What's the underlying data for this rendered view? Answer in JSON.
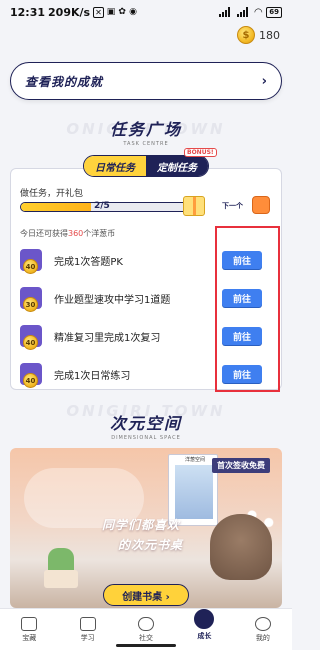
{
  "status_bar": {
    "time": "12:31",
    "speed": "209K/s",
    "battery": "69"
  },
  "header": {
    "coin_count": "180"
  },
  "achievement": {
    "label": "查看我的成就",
    "arrow": "›"
  },
  "task_section": {
    "title": "任务广场",
    "subtitle": "TASK CENTRE",
    "bg_word": "ONIGIRI TOWN",
    "tabs": [
      {
        "label": "日常任务",
        "active": true
      },
      {
        "label": "定制任务",
        "active": false
      }
    ],
    "bonus_tag": "BONUS!",
    "gift_title": "做任务，开礼包",
    "progress": {
      "current": 2,
      "total": 5,
      "text": "2/5"
    },
    "next_label": "下一个",
    "today_prefix": "今日还可获得",
    "today_amount": "360",
    "today_suffix": "个洋葱币",
    "tasks": [
      {
        "reward": "40",
        "label": "完成1次答题PK",
        "button": "前往"
      },
      {
        "reward": "30",
        "label": "作业题型速攻中学习1道题",
        "button": "前往"
      },
      {
        "reward": "40",
        "label": "精准复习里完成1次复习",
        "button": "前往"
      },
      {
        "reward": "40",
        "label": "完成1次日常练习",
        "button": "前往"
      }
    ]
  },
  "space_section": {
    "title": "次元空间",
    "subtitle": "DIMENSIONAL SPACE",
    "bg_word": "ONIGIRI TOWN",
    "banner": {
      "badge": "首次签收免费",
      "book_title": "洋葱空间",
      "slogan_line1": "同学们都喜欢",
      "slogan_line2": "的次元书桌",
      "button": "创建书桌 ›"
    }
  },
  "bottom_nav": [
    {
      "label": "宝藏",
      "icon": "treasure-icon",
      "active": false
    },
    {
      "label": "学习",
      "icon": "book-icon",
      "active": false
    },
    {
      "label": "社交",
      "icon": "chat-icon",
      "active": false
    },
    {
      "label": "成长",
      "icon": "growth-icon",
      "active": true
    },
    {
      "label": "我的",
      "icon": "profile-icon",
      "active": false
    }
  ],
  "colors": {
    "navy": "#1f2257",
    "accent_yellow": "#ffd33d",
    "button_blue": "#3f7ff0",
    "highlight_red": "#e8303c"
  }
}
